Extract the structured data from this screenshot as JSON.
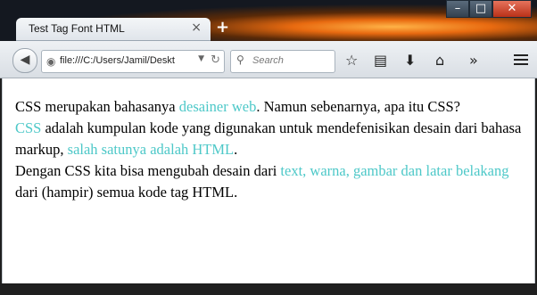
{
  "tab": {
    "title": "Test Tag Font HTML",
    "close": "×"
  },
  "newtab_label": "+",
  "window": {
    "minimize": "–",
    "maximize": "□",
    "close": "✕"
  },
  "address": {
    "url": "file:///C:/Users/Jamil/Deskt"
  },
  "search": {
    "placeholder": "Search"
  },
  "content": {
    "p1a": "CSS merupakan bahasanya ",
    "p1b": "desainer web",
    "p1c": ". Namun sebenarnya, apa itu CSS?",
    "p2a": "CSS",
    "p2b": " adalah kumpulan kode yang digunakan untuk mendefenisikan desain dari bahasa markup, ",
    "p2c": "salah satunya adalah HTML",
    "p2d": ".",
    "p3a": "Dengan CSS kita bisa mengubah desain dari ",
    "p3b": "text, warna, gambar dan latar belakang",
    "p3c": " dari (hampir) semua kode tag HTML."
  },
  "colors": {
    "link": "#4dc8c8"
  },
  "icons": [
    "back-icon",
    "globe-icon",
    "reload-icon",
    "search-icon",
    "bookmark-star-icon",
    "bookmarks-list-icon",
    "download-icon",
    "home-icon",
    "overflow-icon",
    "menu-icon"
  ]
}
